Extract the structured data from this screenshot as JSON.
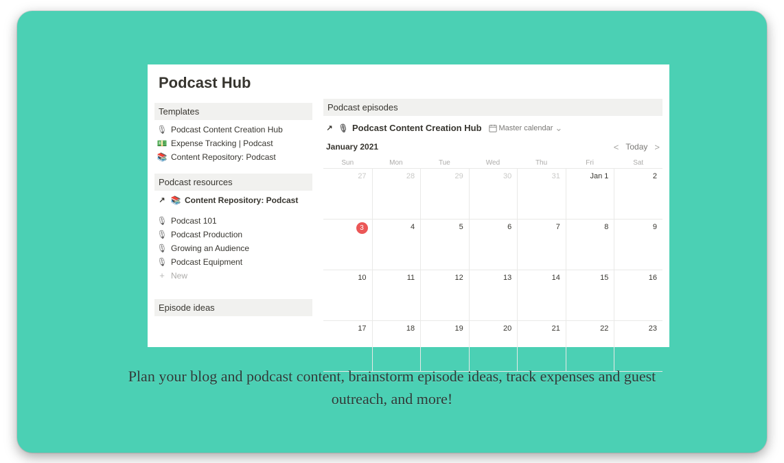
{
  "page": {
    "title": "Podcast Hub"
  },
  "sidebar": {
    "templates_header": "Templates",
    "templates": [
      {
        "icon": "mic",
        "label": "Podcast Content Creation Hub"
      },
      {
        "icon": "money",
        "label": "Expense Tracking | Podcast"
      },
      {
        "icon": "book",
        "label": "Content Repository: Podcast"
      }
    ],
    "resources_header": "Podcast resources",
    "resource_link": {
      "icon": "book",
      "label": "Content Repository: Podcast"
    },
    "resources": [
      {
        "icon": "mic",
        "label": "Podcast 101"
      },
      {
        "icon": "mic",
        "label": "Podcast Production"
      },
      {
        "icon": "mic",
        "label": "Growing an Audience"
      },
      {
        "icon": "mic",
        "label": "Podcast Equipment"
      }
    ],
    "new_label": "New",
    "ideas_header": "Episode ideas"
  },
  "main": {
    "episodes_header": "Podcast episodes",
    "linked_db_title": "Podcast Content Creation Hub",
    "view_label": "Master calendar",
    "calendar": {
      "month_label": "January 2021",
      "today_label": "Today",
      "dow": [
        "Sun",
        "Mon",
        "Tue",
        "Wed",
        "Thu",
        "Fri",
        "Sat"
      ],
      "cells": [
        {
          "d": "27",
          "other": true
        },
        {
          "d": "28",
          "other": true
        },
        {
          "d": "29",
          "other": true
        },
        {
          "d": "30",
          "other": true
        },
        {
          "d": "31",
          "other": true
        },
        {
          "d": "Jan 1"
        },
        {
          "d": "2"
        },
        {
          "d": "3",
          "today": true
        },
        {
          "d": "4"
        },
        {
          "d": "5"
        },
        {
          "d": "6"
        },
        {
          "d": "7"
        },
        {
          "d": "8"
        },
        {
          "d": "9"
        },
        {
          "d": "10"
        },
        {
          "d": "11"
        },
        {
          "d": "12"
        },
        {
          "d": "13"
        },
        {
          "d": "14"
        },
        {
          "d": "15"
        },
        {
          "d": "16"
        },
        {
          "d": "17"
        },
        {
          "d": "18"
        },
        {
          "d": "19"
        },
        {
          "d": "20"
        },
        {
          "d": "21"
        },
        {
          "d": "22"
        },
        {
          "d": "23"
        }
      ]
    }
  },
  "caption": "Plan your blog and podcast content, brainstorm episode ideas, track expenses and guest outreach, and more!"
}
